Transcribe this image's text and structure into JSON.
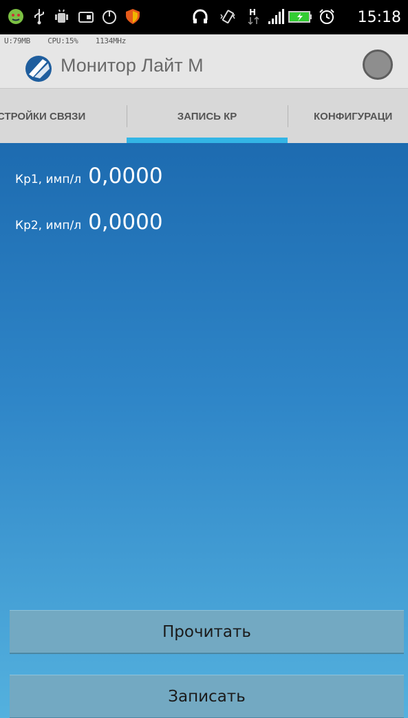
{
  "status_bar": {
    "time": "15:18",
    "icons": [
      "bug-icon",
      "usb-icon",
      "android-debug-icon",
      "sd-card-icon",
      "power-icon",
      "shield-icon",
      "headphones-icon",
      "vibrate-icon",
      "network-h-icon",
      "signal-icon",
      "battery-icon",
      "alarm-icon"
    ]
  },
  "action_bar": {
    "system_stats": "U:79MB    CPU:15%    1134MHz",
    "title": "Монитор Лайт М",
    "status_indicator_color": "#8e8e8e"
  },
  "tabs": [
    {
      "label": "СТРОЙКИ СВЯЗИ"
    },
    {
      "label": "ЗАПИСЬ КР"
    },
    {
      "label": "КОНФИГУРАЦИ"
    }
  ],
  "accent_color": "#33b5e5",
  "fields": [
    {
      "label": "Кр1, имп/л",
      "value": "0,0000"
    },
    {
      "label": "Кр2, имп/л",
      "value": "0,0000"
    }
  ],
  "buttons": {
    "read": "Прочитать",
    "write": "Записать"
  }
}
